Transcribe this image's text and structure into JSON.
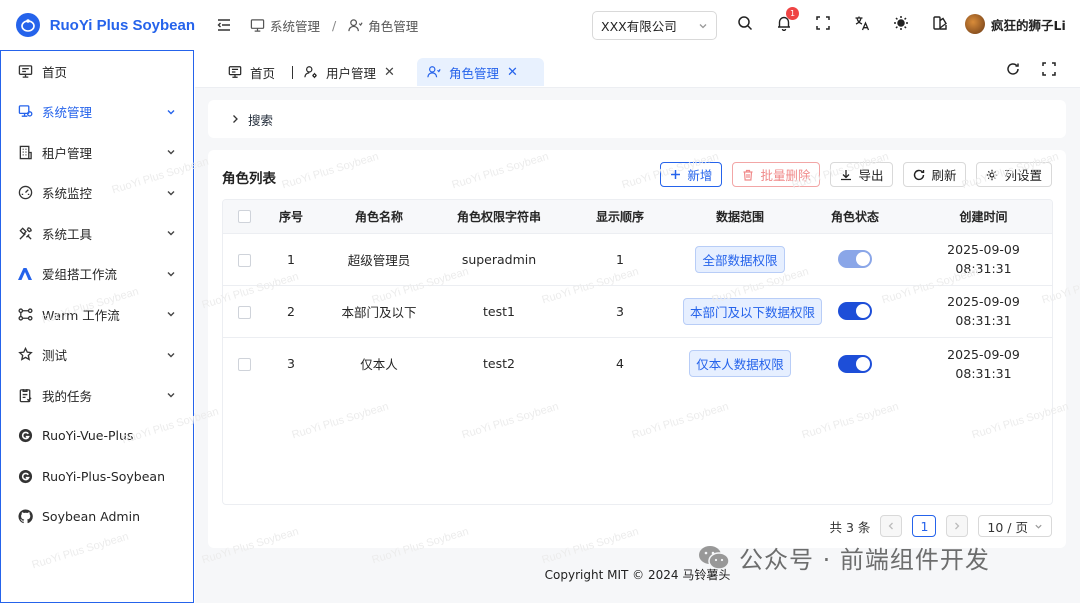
{
  "app": {
    "title": "RuoYi Plus Soybean"
  },
  "sidebar": {
    "items": [
      {
        "label": "首页",
        "icon": "monitor-icon",
        "arrow": false,
        "active": false
      },
      {
        "label": "系统管理",
        "icon": "settings-monitor-icon",
        "arrow": true,
        "active": true
      },
      {
        "label": "租户管理",
        "icon": "building-icon",
        "arrow": true,
        "active": false
      },
      {
        "label": "系统监控",
        "icon": "gauge-icon",
        "arrow": true,
        "active": false
      },
      {
        "label": "系统工具",
        "icon": "tools-icon",
        "arrow": true,
        "active": false
      },
      {
        "label": "爱组搭工作流",
        "icon": "aizu-logo-icon",
        "arrow": true,
        "active": false
      },
      {
        "label": "Warm 工作流",
        "icon": "flow-icon",
        "arrow": true,
        "active": false
      },
      {
        "label": "测试",
        "icon": "star-icon",
        "arrow": true,
        "active": false
      },
      {
        "label": "我的任务",
        "icon": "task-icon",
        "arrow": true,
        "active": false
      },
      {
        "label": "RuoYi-Vue-Plus",
        "icon": "g-logo-icon",
        "arrow": false,
        "active": false
      },
      {
        "label": "RuoYi-Plus-Soybean",
        "icon": "g-logo-icon",
        "arrow": false,
        "active": false
      },
      {
        "label": "Soybean Admin",
        "icon": "github-icon",
        "arrow": false,
        "active": false
      }
    ]
  },
  "header": {
    "breadcrumb": [
      "系统管理",
      "角色管理"
    ],
    "company": "XXX有限公司",
    "notification_count": "1",
    "user_name": "疯狂的狮子Li"
  },
  "tabs": [
    {
      "label": "首页",
      "closable": false,
      "active": false
    },
    {
      "label": "用户管理",
      "closable": true,
      "active": false
    },
    {
      "label": "角色管理",
      "closable": true,
      "active": true
    }
  ],
  "search": {
    "label": "搜索"
  },
  "list": {
    "title": "角色列表",
    "toolbar": {
      "add": "新增",
      "batch_delete": "批量删除",
      "export": "导出",
      "refresh": "刷新",
      "columns": "列设置"
    },
    "columns": [
      "序号",
      "角色名称",
      "角色权限字符串",
      "显示顺序",
      "数据范围",
      "角色状态",
      "创建时间"
    ],
    "rows": [
      {
        "index": "1",
        "name": "超级管理员",
        "key": "superadmin",
        "order": "1",
        "scope": "全部数据权限",
        "status_on": true,
        "status_disabled": true,
        "date": "2025-09-09",
        "time": "08:31:31"
      },
      {
        "index": "2",
        "name": "本部门及以下",
        "key": "test1",
        "order": "3",
        "scope": "本部门及以下数据权限",
        "status_on": true,
        "status_disabled": false,
        "date": "2025-09-09",
        "time": "08:31:31"
      },
      {
        "index": "3",
        "name": "仅本人",
        "key": "test2",
        "order": "4",
        "scope": "仅本人数据权限",
        "status_on": true,
        "status_disabled": false,
        "date": "2025-09-09",
        "time": "08:31:31"
      }
    ],
    "pagination": {
      "total_text": "共 3 条",
      "current_page": "1",
      "page_size": "10 / 页"
    }
  },
  "footer": {
    "copyright": "Copyright MIT © 2024 马铃薯头"
  },
  "overlay": {
    "text": "公众号 · 前端组件开发"
  },
  "watermark_text": "RuoYi Plus Soybean",
  "colors": {
    "accent": "#2563eb",
    "danger": "#f08a8a",
    "badge": "#ef4444"
  }
}
